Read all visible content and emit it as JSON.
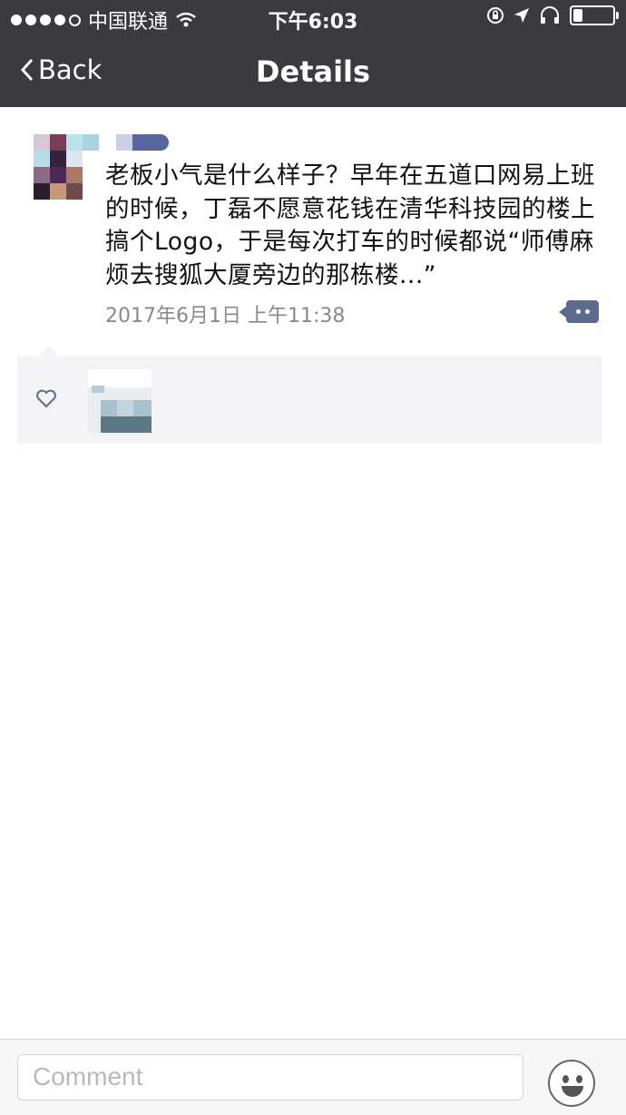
{
  "status_bar": {
    "carrier": "中国联通",
    "time": "下午6:03"
  },
  "nav": {
    "back_label": "Back",
    "title": "Details"
  },
  "post": {
    "text": "老板小气是什么样子？早年在五道口网易上班的时候，丁磊不愿意花钱在清华科技园的楼上搞个Logo，于是每次打车的时候都说“师傅麻烦去搜狐大厦旁边的那栋楼...”",
    "date": "2017年6月1日 上午11:38",
    "comment_icon": "comment-bubble-icon"
  },
  "likes": {
    "icon": "heart-icon"
  },
  "bottom_bar": {
    "comment_placeholder": "Comment",
    "emoji_icon": "smiley-face-icon"
  },
  "colors": {
    "nav_background": "#3b3b3f",
    "accent": "#5d6b8f",
    "likes_background": "#f3f3f5"
  }
}
